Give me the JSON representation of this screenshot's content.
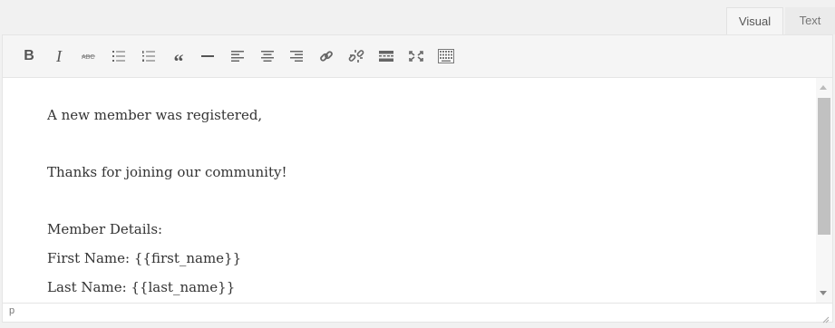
{
  "tabs": {
    "visual": "Visual",
    "text": "Text"
  },
  "toolbar": {
    "bold": "B",
    "italic": "I",
    "blockquote": "“"
  },
  "content": {
    "lines": [
      "A new member was registered,",
      "Thanks for joining our community!",
      "Member Details:",
      "First Name: {{first_name}}",
      "Last Name: {{last_name}}"
    ]
  },
  "statusbar": {
    "path": "p"
  },
  "colors": {
    "icon": "#555555",
    "border": "#e5e5e5",
    "toolbar_bg": "#f5f5f5"
  }
}
